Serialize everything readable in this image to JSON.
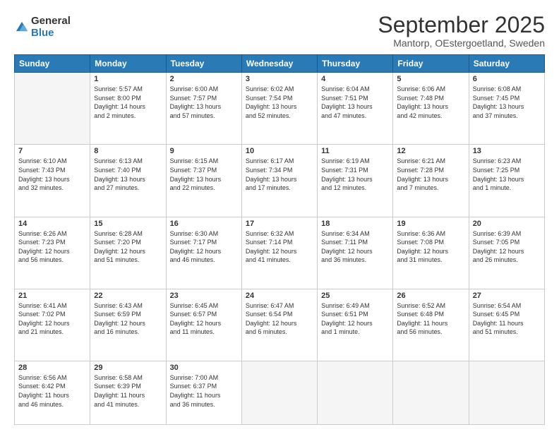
{
  "header": {
    "logo_general": "General",
    "logo_blue": "Blue",
    "month_title": "September 2025",
    "location": "Mantorp, OEstergoetland, Sweden"
  },
  "weekdays": [
    "Sunday",
    "Monday",
    "Tuesday",
    "Wednesday",
    "Thursday",
    "Friday",
    "Saturday"
  ],
  "weeks": [
    [
      {
        "day": "",
        "info": ""
      },
      {
        "day": "1",
        "info": "Sunrise: 5:57 AM\nSunset: 8:00 PM\nDaylight: 14 hours\nand 2 minutes."
      },
      {
        "day": "2",
        "info": "Sunrise: 6:00 AM\nSunset: 7:57 PM\nDaylight: 13 hours\nand 57 minutes."
      },
      {
        "day": "3",
        "info": "Sunrise: 6:02 AM\nSunset: 7:54 PM\nDaylight: 13 hours\nand 52 minutes."
      },
      {
        "day": "4",
        "info": "Sunrise: 6:04 AM\nSunset: 7:51 PM\nDaylight: 13 hours\nand 47 minutes."
      },
      {
        "day": "5",
        "info": "Sunrise: 6:06 AM\nSunset: 7:48 PM\nDaylight: 13 hours\nand 42 minutes."
      },
      {
        "day": "6",
        "info": "Sunrise: 6:08 AM\nSunset: 7:45 PM\nDaylight: 13 hours\nand 37 minutes."
      }
    ],
    [
      {
        "day": "7",
        "info": "Sunrise: 6:10 AM\nSunset: 7:43 PM\nDaylight: 13 hours\nand 32 minutes."
      },
      {
        "day": "8",
        "info": "Sunrise: 6:13 AM\nSunset: 7:40 PM\nDaylight: 13 hours\nand 27 minutes."
      },
      {
        "day": "9",
        "info": "Sunrise: 6:15 AM\nSunset: 7:37 PM\nDaylight: 13 hours\nand 22 minutes."
      },
      {
        "day": "10",
        "info": "Sunrise: 6:17 AM\nSunset: 7:34 PM\nDaylight: 13 hours\nand 17 minutes."
      },
      {
        "day": "11",
        "info": "Sunrise: 6:19 AM\nSunset: 7:31 PM\nDaylight: 13 hours\nand 12 minutes."
      },
      {
        "day": "12",
        "info": "Sunrise: 6:21 AM\nSunset: 7:28 PM\nDaylight: 13 hours\nand 7 minutes."
      },
      {
        "day": "13",
        "info": "Sunrise: 6:23 AM\nSunset: 7:25 PM\nDaylight: 13 hours\nand 1 minute."
      }
    ],
    [
      {
        "day": "14",
        "info": "Sunrise: 6:26 AM\nSunset: 7:23 PM\nDaylight: 12 hours\nand 56 minutes."
      },
      {
        "day": "15",
        "info": "Sunrise: 6:28 AM\nSunset: 7:20 PM\nDaylight: 12 hours\nand 51 minutes."
      },
      {
        "day": "16",
        "info": "Sunrise: 6:30 AM\nSunset: 7:17 PM\nDaylight: 12 hours\nand 46 minutes."
      },
      {
        "day": "17",
        "info": "Sunrise: 6:32 AM\nSunset: 7:14 PM\nDaylight: 12 hours\nand 41 minutes."
      },
      {
        "day": "18",
        "info": "Sunrise: 6:34 AM\nSunset: 7:11 PM\nDaylight: 12 hours\nand 36 minutes."
      },
      {
        "day": "19",
        "info": "Sunrise: 6:36 AM\nSunset: 7:08 PM\nDaylight: 12 hours\nand 31 minutes."
      },
      {
        "day": "20",
        "info": "Sunrise: 6:39 AM\nSunset: 7:05 PM\nDaylight: 12 hours\nand 26 minutes."
      }
    ],
    [
      {
        "day": "21",
        "info": "Sunrise: 6:41 AM\nSunset: 7:02 PM\nDaylight: 12 hours\nand 21 minutes."
      },
      {
        "day": "22",
        "info": "Sunrise: 6:43 AM\nSunset: 6:59 PM\nDaylight: 12 hours\nand 16 minutes."
      },
      {
        "day": "23",
        "info": "Sunrise: 6:45 AM\nSunset: 6:57 PM\nDaylight: 12 hours\nand 11 minutes."
      },
      {
        "day": "24",
        "info": "Sunrise: 6:47 AM\nSunset: 6:54 PM\nDaylight: 12 hours\nand 6 minutes."
      },
      {
        "day": "25",
        "info": "Sunrise: 6:49 AM\nSunset: 6:51 PM\nDaylight: 12 hours\nand 1 minute."
      },
      {
        "day": "26",
        "info": "Sunrise: 6:52 AM\nSunset: 6:48 PM\nDaylight: 11 hours\nand 56 minutes."
      },
      {
        "day": "27",
        "info": "Sunrise: 6:54 AM\nSunset: 6:45 PM\nDaylight: 11 hours\nand 51 minutes."
      }
    ],
    [
      {
        "day": "28",
        "info": "Sunrise: 6:56 AM\nSunset: 6:42 PM\nDaylight: 11 hours\nand 46 minutes."
      },
      {
        "day": "29",
        "info": "Sunrise: 6:58 AM\nSunset: 6:39 PM\nDaylight: 11 hours\nand 41 minutes."
      },
      {
        "day": "30",
        "info": "Sunrise: 7:00 AM\nSunset: 6:37 PM\nDaylight: 11 hours\nand 36 minutes."
      },
      {
        "day": "",
        "info": ""
      },
      {
        "day": "",
        "info": ""
      },
      {
        "day": "",
        "info": ""
      },
      {
        "day": "",
        "info": ""
      }
    ]
  ]
}
